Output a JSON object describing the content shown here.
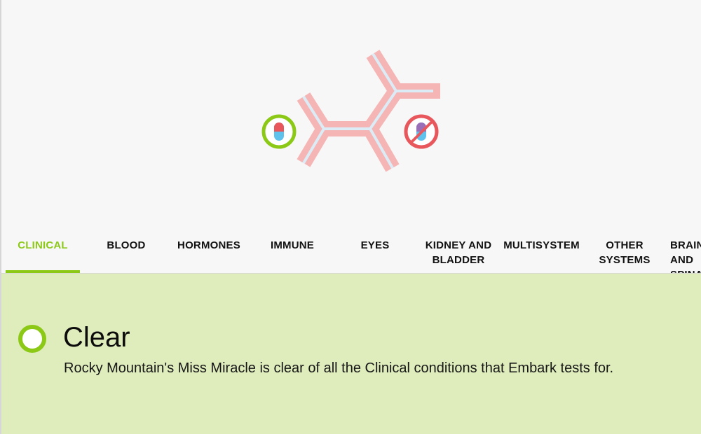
{
  "colors": {
    "accent": "#8cc917",
    "antibody": "#f5b5b5",
    "antibody_core": "#dcecf6",
    "warning": "#e8575b",
    "panel_background": "#dfedbd"
  },
  "hero": {
    "illustration": "immune-antibody-icon",
    "left_badge_icon": "pill-allowed-icon",
    "right_badge_icon": "pill-blocked-icon"
  },
  "tabs": [
    {
      "label": "CLINICAL",
      "active": true
    },
    {
      "label": "BLOOD",
      "active": false
    },
    {
      "label": "HORMONES",
      "active": false
    },
    {
      "label": "IMMUNE",
      "active": false
    },
    {
      "label": "EYES",
      "active": false
    },
    {
      "label": "KIDNEY AND BLADDER",
      "active": false
    },
    {
      "label": "MULTISYSTEM",
      "active": false
    },
    {
      "label": "OTHER SYSTEMS",
      "active": false
    },
    {
      "label": "BRAIN AND SPINAL CORD",
      "active": false
    }
  ],
  "result": {
    "status_icon": "clear-status-icon",
    "title": "Clear",
    "description": "Rocky Mountain's Miss Miracle is clear of all the Clinical conditions that Embark tests for."
  }
}
